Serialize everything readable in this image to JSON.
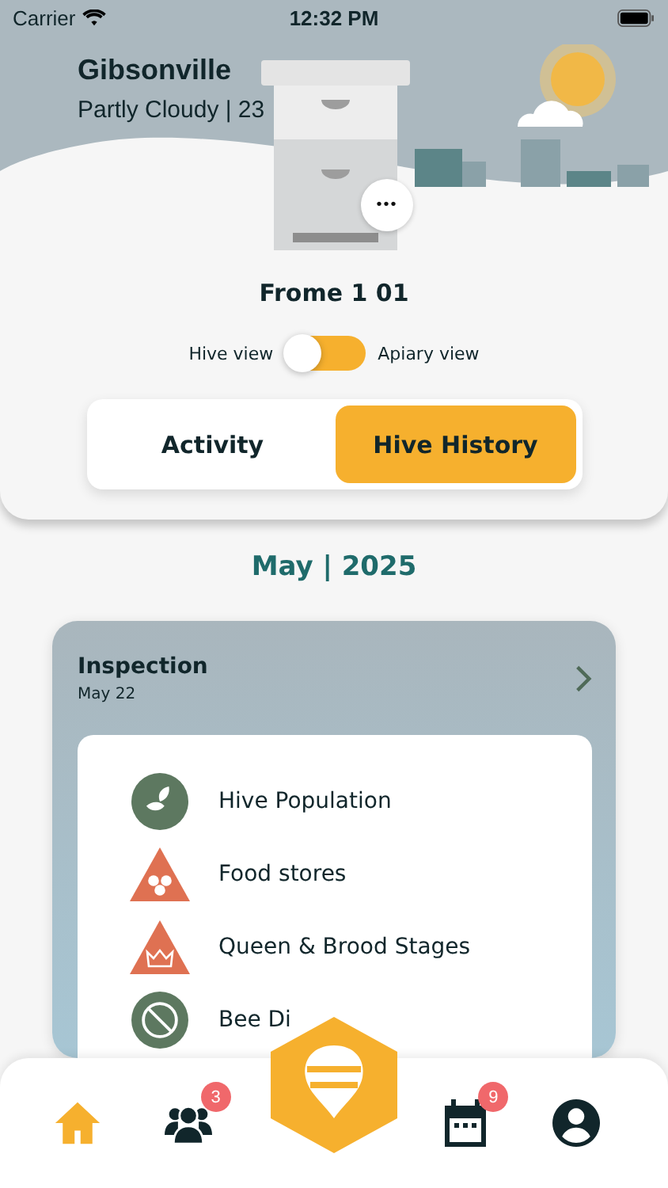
{
  "status_bar": {
    "carrier": "Carrier",
    "time": "12:32 PM"
  },
  "location": {
    "city": "Gibsonville",
    "weather": "Partly Cloudy | 23"
  },
  "hive": {
    "name": "Frome 1 01",
    "menu_button": "•••"
  },
  "view_toggle": {
    "left_label": "Hive view",
    "right_label": "Apiary view",
    "on": false
  },
  "tabs": [
    {
      "label": "Activity",
      "selected": false
    },
    {
      "label": "Hive History",
      "selected": true
    }
  ],
  "month_heading": "May | 2025",
  "inspection": {
    "title": "Inspection",
    "date": "May 22",
    "items": [
      {
        "label": "Hive Population",
        "kind": "circle",
        "color": "#5d7860"
      },
      {
        "label": "Food stores",
        "kind": "triangle",
        "color": "#df7152"
      },
      {
        "label": "Queen & Brood Stages",
        "kind": "triangle",
        "color": "#df7152"
      },
      {
        "label": "Bee Di",
        "kind": "circle",
        "color": "#5d7860"
      }
    ]
  },
  "nav": [
    {
      "kind": "home",
      "selected": true
    },
    {
      "kind": "people",
      "selected": false,
      "badge": "3"
    },
    {
      "kind": "hive",
      "selected": false
    },
    {
      "kind": "calendar",
      "selected": false,
      "badge": "9"
    },
    {
      "kind": "profile",
      "selected": false
    }
  ]
}
